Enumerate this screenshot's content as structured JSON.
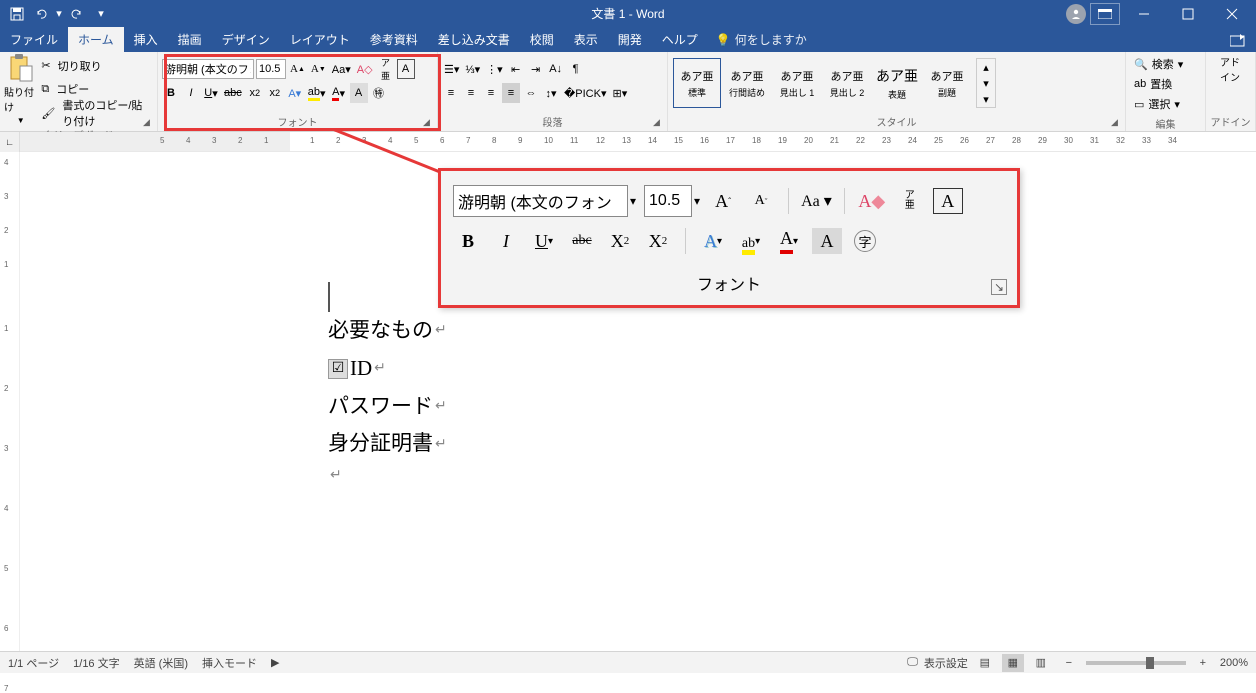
{
  "title": "文書 1  -  Word",
  "qat": {
    "save": "保存",
    "undo": "元に戻す",
    "redo": "繰り返し"
  },
  "tabs": {
    "file": "ファイル",
    "home": "ホーム",
    "insert": "挿入",
    "draw": "描画",
    "design": "デザイン",
    "layout": "レイアウト",
    "references": "参考資料",
    "mailings": "差し込み文書",
    "review": "校閲",
    "view": "表示",
    "developer": "開発",
    "help": "ヘルプ",
    "tellme": "何をしますか"
  },
  "ribbon": {
    "clipboard": {
      "label": "クリップボード",
      "paste": "貼り付け",
      "cut": "切り取り",
      "copy": "コピー",
      "formatpainter": "書式のコピー/貼り付け"
    },
    "font": {
      "label": "フォント",
      "fontname": "游明朝 (本文のフォン",
      "fontsize": "10.5"
    },
    "paragraph": {
      "label": "段落"
    },
    "styles": {
      "label": "スタイル",
      "items": [
        {
          "preview": "あア亜",
          "name": "標準"
        },
        {
          "preview": "あア亜",
          "name": "行間詰め"
        },
        {
          "preview": "あア亜",
          "name": "見出し 1"
        },
        {
          "preview": "あア亜",
          "name": "見出し 2"
        },
        {
          "preview": "あア亜",
          "name": "表題"
        },
        {
          "preview": "あア亜",
          "name": "副題"
        }
      ]
    },
    "editing": {
      "label": "編集",
      "find": "検索",
      "replace": "置換",
      "select": "選択"
    },
    "addins": {
      "label": "アドイン",
      "btn": "アド\nイン"
    }
  },
  "callout": {
    "fontname": "游明朝 (本文のフォン",
    "fontsize": "10.5",
    "label": "フォント"
  },
  "document": {
    "lines": [
      {
        "text": "必要なもの",
        "checkbox": false
      },
      {
        "text": "ID",
        "checkbox": true
      },
      {
        "text": "パスワード",
        "checkbox": false
      },
      {
        "text": "身分証明書",
        "checkbox": false
      }
    ]
  },
  "status": {
    "page": "1/1 ページ",
    "words": "1/16 文字",
    "lang": "英語 (米国)",
    "mode": "挿入モード",
    "display": "表示設定",
    "zoom": "200%"
  },
  "ruler": {
    "left": [
      "5",
      "4",
      "3",
      "2",
      "1"
    ],
    "right": [
      "1",
      "2",
      "3",
      "4",
      "5",
      "6",
      "7",
      "8",
      "9",
      "10",
      "11",
      "12",
      "13",
      "14",
      "15",
      "16",
      "17",
      "18",
      "19",
      "20",
      "21",
      "22",
      "23",
      "24",
      "25",
      "26",
      "27",
      "28",
      "29",
      "30",
      "31",
      "32",
      "33",
      "34"
    ]
  }
}
